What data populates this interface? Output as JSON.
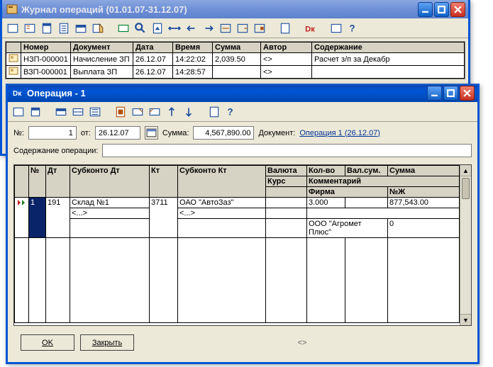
{
  "journal": {
    "title": "Журнал операций (01.01.07-31.12.07)",
    "columns": [
      "Номер",
      "Документ",
      "Дата",
      "Время",
      "Сумма",
      "Автор",
      "Содержание"
    ],
    "rows": [
      {
        "num": "НЗП-000001",
        "doc": "Начисление ЗП",
        "date": "26.12.07",
        "time": "14:22:02",
        "sum": "2,039.50",
        "author": "<>",
        "content": "Расчет з/п за Декабр"
      },
      {
        "num": "ВЗП-000001",
        "doc": "Выплата ЗП",
        "date": "26.12.07",
        "time": "14:28:57",
        "sum": "",
        "author": "<>",
        "content": ""
      }
    ]
  },
  "op": {
    "title": "Операция - 1",
    "header": {
      "num_label": "№:",
      "num_value": "1",
      "from_label": "от:",
      "date_value": "26.12.07",
      "sum_label": "Сумма:",
      "sum_value": "4,567,890.00",
      "doc_label": "Документ:",
      "doc_link": "Операция 1 (26.12.07)",
      "content_label": "Содержание операции:"
    },
    "grid": {
      "h1": [
        "№",
        "Дт",
        "Субконто Дт",
        "Кт",
        "Субконто Кт",
        "Валюта",
        "Кол-во",
        "Вал.сум.",
        "Сумма"
      ],
      "h2_5": "Курс",
      "h2_6": "Комментарий",
      "h3_6": "Фирма",
      "h3_9": "№Ж",
      "row": {
        "num": "1",
        "dt": "191",
        "sub_dt": "Склад №1",
        "sub_dt2": "<...>",
        "kt": "3711",
        "sub_kt": "ОАО \"АвтоЗаз\"",
        "sub_kt2": "<...>",
        "qty": "3.000",
        "sum": "877,543.00",
        "firm": "ООО \"Агромет Плюс\"",
        "nzh": "0"
      }
    },
    "buttons": {
      "ok": "OK",
      "close": "Закрыть"
    },
    "status_glyph": "<>"
  }
}
